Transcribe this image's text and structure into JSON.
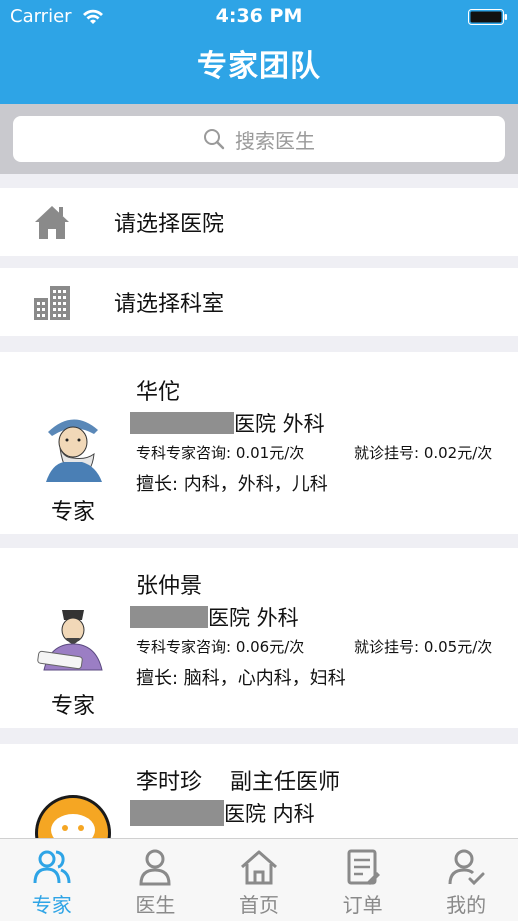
{
  "status": {
    "carrier": "Carrier",
    "time": "4:36 PM"
  },
  "header": {
    "title": "专家团队"
  },
  "search": {
    "placeholder": "搜索医生"
  },
  "filters": [
    {
      "label": "请选择医院",
      "icon": "hospital-icon"
    },
    {
      "label": "请选择科室",
      "icon": "building-icon"
    }
  ],
  "doctors": [
    {
      "name": "华佗",
      "title": "",
      "hospital_suffix": "医院 外科",
      "consult_fee": "专科专家咨询: 0.01元/次",
      "reg_fee": "就诊挂号: 0.02元/次",
      "specialty": "擅长: 内科，外科，儿科",
      "tag": "专家"
    },
    {
      "name": "张仲景",
      "title": "",
      "hospital_suffix": "医院 外科",
      "consult_fee": "专科专家咨询: 0.06元/次",
      "reg_fee": "就诊挂号: 0.05元/次",
      "specialty": "擅长: 脑科，心内科，妇科",
      "tag": "专家"
    },
    {
      "name": "李时珍",
      "title": "副主任医师",
      "hospital_suffix": "医院 内科"
    }
  ],
  "tabs": [
    {
      "label": "专家",
      "icon": "experts-icon",
      "active": true
    },
    {
      "label": "医生",
      "icon": "doctor-icon"
    },
    {
      "label": "首页",
      "icon": "home-icon"
    },
    {
      "label": "订单",
      "icon": "orders-icon"
    },
    {
      "label": "我的",
      "icon": "profile-icon"
    }
  ],
  "colors": {
    "accent": "#2ea4e6",
    "background": "#efeff4",
    "inactive": "#8a8a8a"
  }
}
